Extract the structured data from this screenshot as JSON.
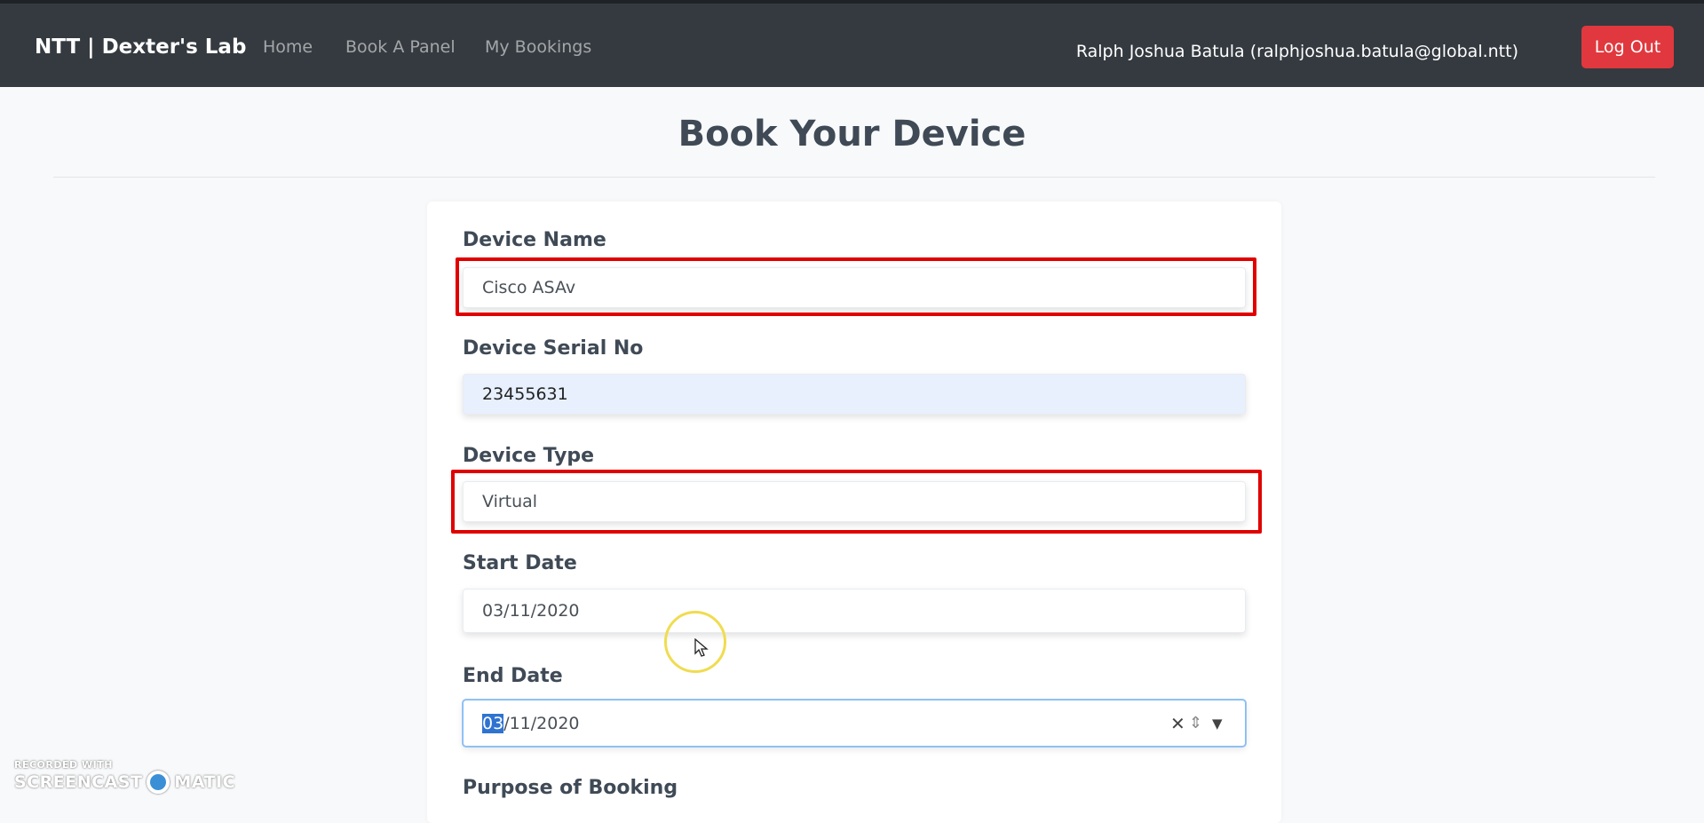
{
  "navbar": {
    "brand": "NTT | Dexter's Lab",
    "links": [
      "Home",
      "Book A Panel",
      "My Bookings"
    ],
    "user": "Ralph Joshua Batula (ralphjoshua.batula@global.ntt)",
    "logout_label": "Log Out"
  },
  "page": {
    "title": "Book Your Device"
  },
  "form": {
    "device_name": {
      "label": "Device Name",
      "value": "Cisco ASAv"
    },
    "serial": {
      "label": "Device Serial No",
      "value": "23455631"
    },
    "device_type": {
      "label": "Device Type",
      "value": "Virtual"
    },
    "start_date": {
      "label": "Start Date",
      "value": "03/11/2020"
    },
    "end_date": {
      "label": "End Date",
      "value_selected": "03",
      "value_rest": "/11/2020",
      "clear_glyph": "✕",
      "spin_glyph": "⇕",
      "dropdown_glyph": "▼"
    },
    "purpose": {
      "label": "Purpose of Booking"
    }
  },
  "watermark": {
    "line1": "RECORDED WITH",
    "line2a": "SCREENCAST",
    "line2b": "MATIC"
  },
  "colors": {
    "navbar": "#343a40",
    "logout": "#e0383e",
    "highlight": "#e00000",
    "autofill": "#e8f0fe"
  }
}
